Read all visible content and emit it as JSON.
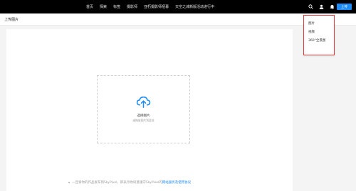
{
  "nav": {
    "items": [
      {
        "label": "首页"
      },
      {
        "label": "探索"
      },
      {
        "label": "标签"
      },
      {
        "label": "摄影师"
      },
      {
        "label": "亚朽摄影师招募"
      },
      {
        "label": "天空之城新版活动进行中"
      }
    ],
    "upload_label": "上传"
  },
  "page": {
    "title": "上传图片"
  },
  "dropzone": {
    "title": "选择图片",
    "hint": "或拖放图片到此处"
  },
  "notice": {
    "text": "一旦将你的作品发布到SkyPixel，即表示你同意遵守SkyPixel的",
    "link": "网站服务及使用协议"
  },
  "dropdown": {
    "items": [
      {
        "label": "图片"
      },
      {
        "label": "视频"
      },
      {
        "label": "360°全景图"
      }
    ]
  },
  "colors": {
    "accent": "#1d8cf8",
    "highlight_border": "#e53935",
    "nav_bg": "#000000"
  },
  "icons": [
    "search-icon",
    "user-icon",
    "bell-icon",
    "cloud-upload-icon"
  ]
}
